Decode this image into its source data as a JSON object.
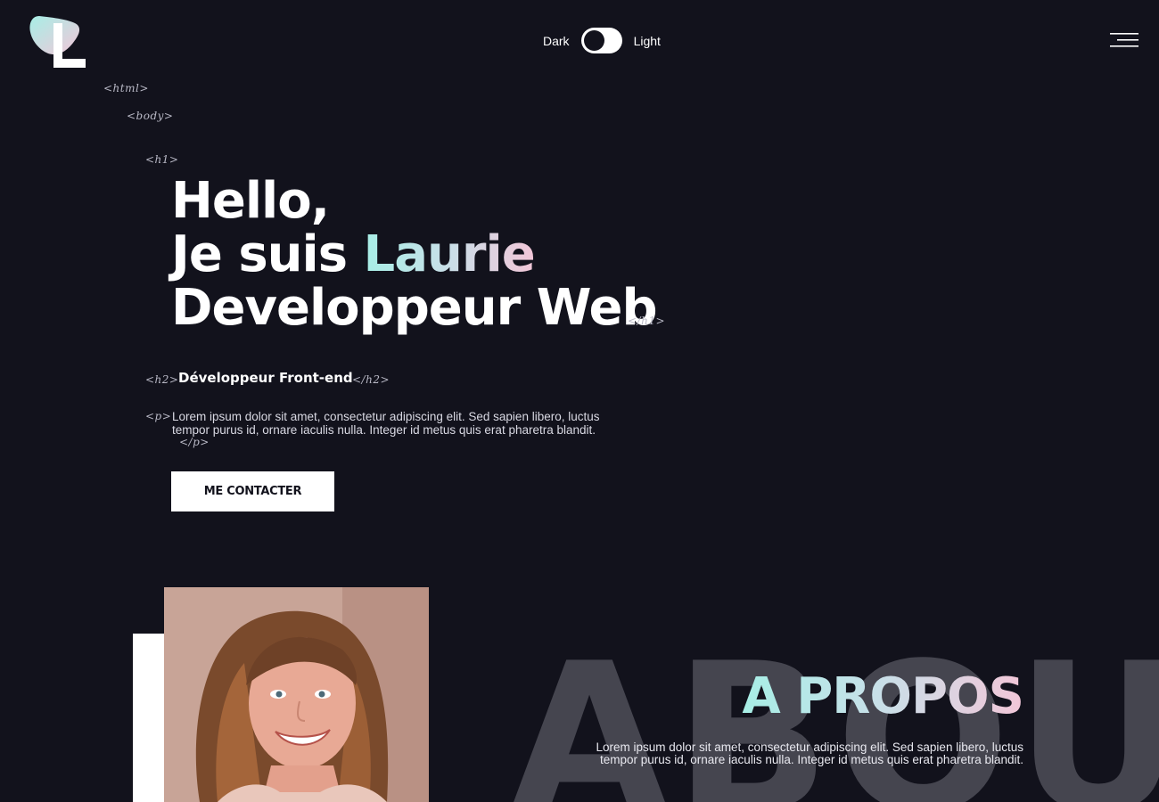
{
  "header": {
    "logo_letter": "L",
    "theme_toggle": {
      "dark_label": "Dark",
      "light_label": "Light",
      "state": "dark"
    }
  },
  "code_tags": {
    "html_open": "<html>",
    "body_open": "<body>",
    "h1_open": "<h1>",
    "h1_close": "</h1>",
    "h2_open": "<h2>",
    "h2_close": "</h2>",
    "p_open": "<p>",
    "p_close": "</p>"
  },
  "hero": {
    "line1": "Hello,",
    "line2_prefix": "Je suis ",
    "line2_name": "Laurie",
    "line3": "Developpeur Web",
    "subtitle": "Développeur Front-end",
    "paragraph": "Lorem ipsum dolor sit amet, consectetur adipiscing elit. Sed sapien libero, luctus tempor purus id, ornare iaculis nulla. Integer id metus quis erat pharetra blandit.",
    "cta_label": "ME CONTACTER"
  },
  "about": {
    "background_word": "ABOU",
    "title": "A PROPOS",
    "paragraph": "Lorem ipsum dolor sit amet, consectetur adipiscing elit. Sed sapien libero, luctus tempor purus id, ornare iaculis nulla. Integer id metus quis erat pharetra blandit."
  },
  "colors": {
    "background": "#12121c",
    "gradient_start": "#a7eee6",
    "gradient_end": "#f2c6d8",
    "background_word": "#45454f"
  }
}
